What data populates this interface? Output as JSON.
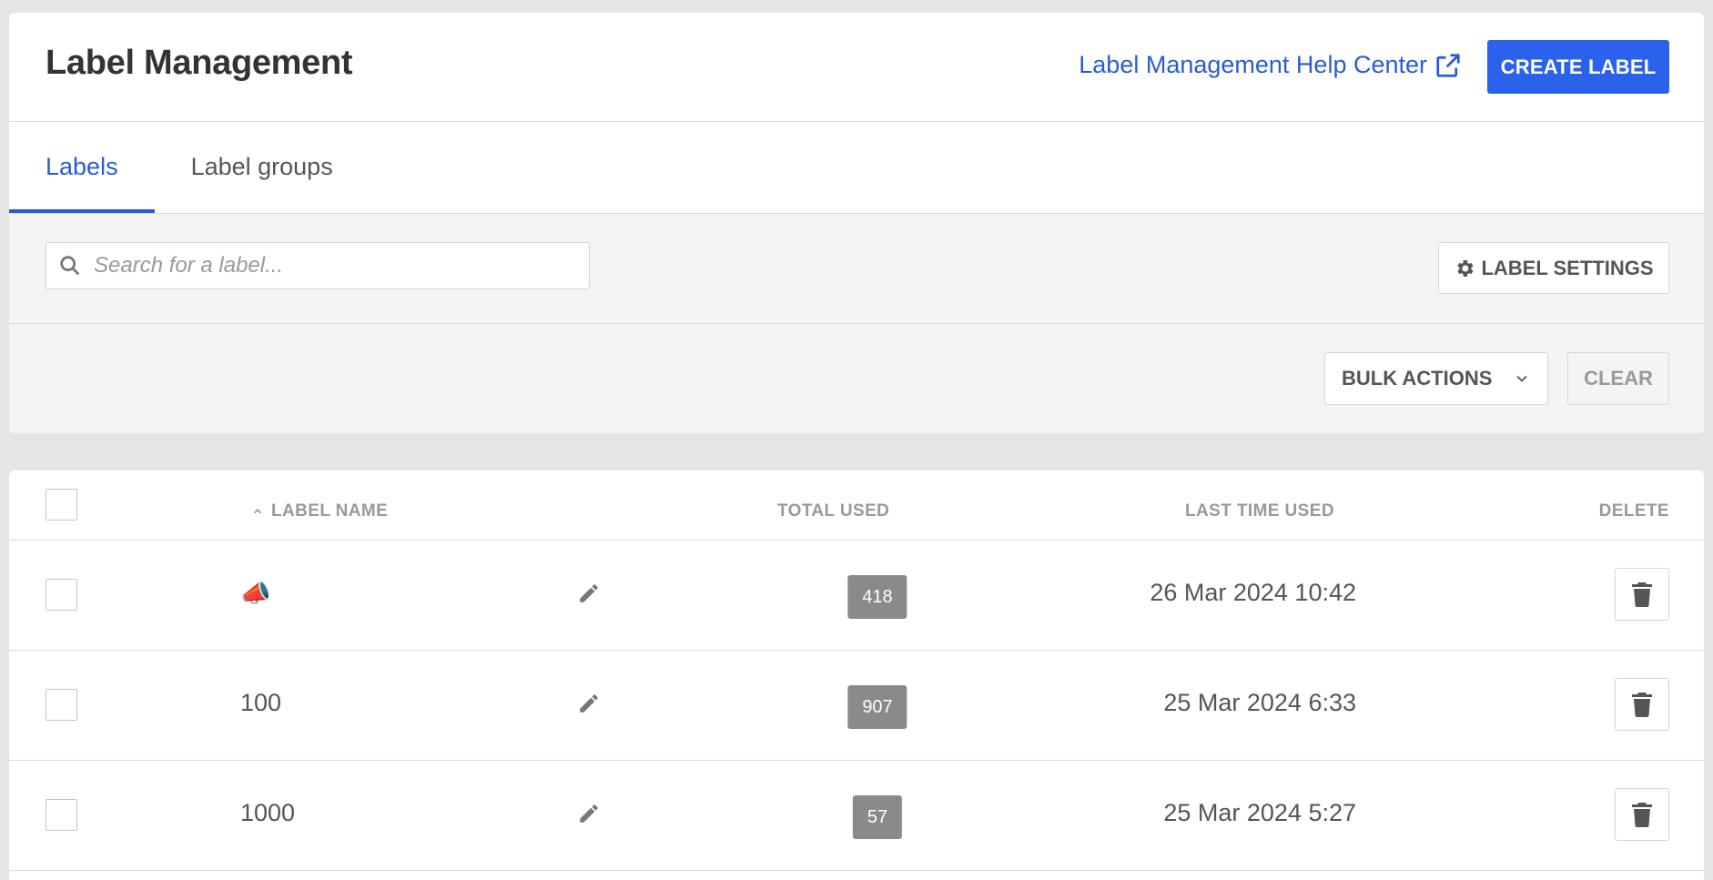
{
  "header": {
    "title": "Label Management",
    "help_link": "Label Management Help Center",
    "create_button": "CREATE LABEL"
  },
  "tabs": [
    {
      "label": "Labels",
      "active": true
    },
    {
      "label": "Label groups",
      "active": false
    }
  ],
  "search": {
    "placeholder": "Search for a label...",
    "value": ""
  },
  "toolbar": {
    "settings_button": "LABEL SETTINGS",
    "bulk_actions": "BULK ACTIONS",
    "clear_button": "CLEAR"
  },
  "table": {
    "columns": {
      "label_name": "LABEL NAME",
      "total_used": "TOTAL USED",
      "last_time_used": "LAST TIME USED",
      "delete": "DELETE"
    },
    "sort": {
      "column": "label_name",
      "direction": "ascending"
    },
    "rows": [
      {
        "name": "📣",
        "total_used": "418",
        "last_time_used": "26 Mar 2024 10:42"
      },
      {
        "name": "100",
        "total_used": "907",
        "last_time_used": "25 Mar 2024 6:33"
      },
      {
        "name": "1000",
        "total_used": "57",
        "last_time_used": "25 Mar 2024 5:27"
      }
    ]
  },
  "colors": {
    "accent": "#2a62ee",
    "link": "#2a5bd7",
    "badge": "#8a8a8a",
    "background": "#e5e5e5"
  },
  "icons": {
    "external_link": "external-link-icon",
    "search": "search-icon",
    "settings": "gear-icon",
    "dropdown": "chevron-down-icon",
    "sort": "chevron-up-icon",
    "edit": "pencil-icon",
    "delete": "trash-icon"
  }
}
